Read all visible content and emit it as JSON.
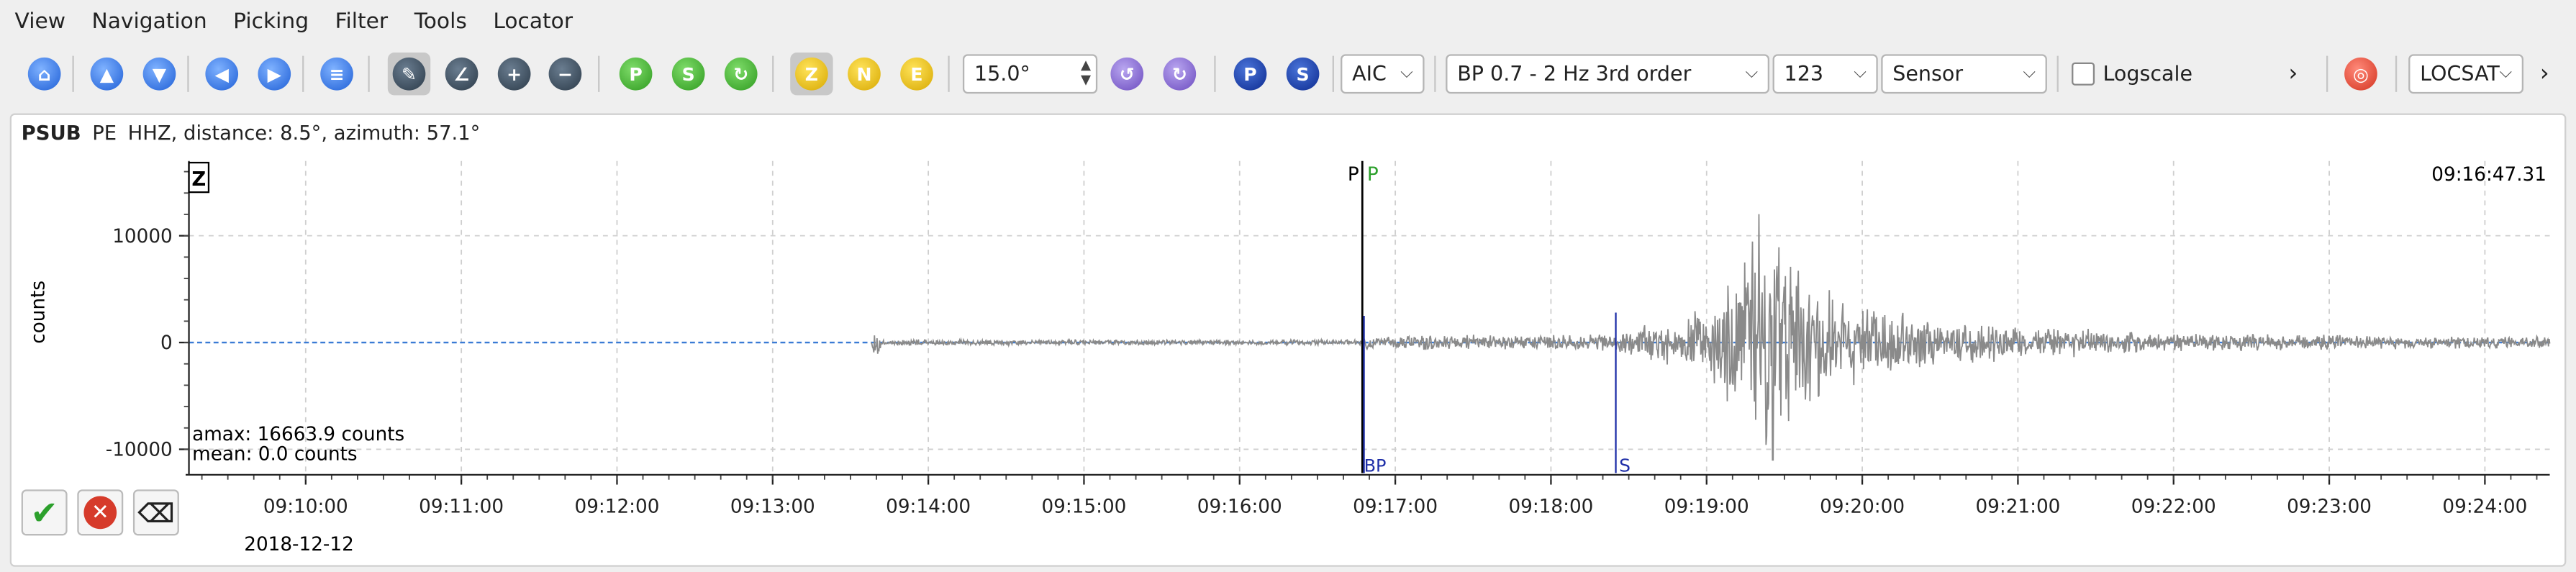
{
  "menu": [
    "View",
    "Navigation",
    "Picking",
    "Filter",
    "Tools",
    "Locator"
  ],
  "toolbar": {
    "angle_value": "15.0°",
    "method": "AIC",
    "filter": "BP 0.7 - 2 Hz  3rd order",
    "components": "123",
    "unit_mode": "Sensor",
    "logscale_label": "Logscale",
    "logscale_checked": false,
    "locator": "LOCSAT",
    "component_buttons": [
      "Z",
      "N",
      "E"
    ],
    "phase_buttons": [
      "P",
      "S"
    ],
    "icons": [
      "home-icon",
      "scroll-up-icon",
      "scroll-down-icon",
      "previous-trace-icon",
      "next-trace-icon",
      "align-icon",
      "pick-tool-icon",
      "angle-tool-icon",
      "zoom-in-icon",
      "zoom-out-icon",
      "pick-p-icon",
      "pick-s-icon",
      "pick-refresh-icon",
      "rotate-left-icon",
      "rotate-right-icon",
      "more-icon",
      "locate-target-icon",
      "overflow-icon"
    ]
  },
  "trace": {
    "station": "PSUB",
    "network": "PE",
    "channel_info": "HHZ, distance: 8.5°, azimuth: 57.1°",
    "component_tag": "Z",
    "time_right": "09:16:47.31",
    "ylabel": "counts",
    "amax_text": "amax: 16663.9 counts",
    "mean_text": "mean: 0.0 counts",
    "date": "2018-12-12",
    "pick_labels": {
      "p_black": "P",
      "p_green": "P",
      "bottom_p": "BP",
      "s": "S"
    }
  },
  "chart_data": {
    "type": "line",
    "title": "",
    "xlabel": "",
    "ylabel": "counts",
    "ylim": [
      -11000,
      17000
    ],
    "yticks": [
      10000,
      0,
      -10000
    ],
    "ytick_labels": [
      "10000",
      "0",
      "-10000"
    ],
    "x_ticks": [
      "09:10:00",
      "09:11:00",
      "09:12:00",
      "09:13:00",
      "09:14:00",
      "09:15:00",
      "09:16:00",
      "09:17:00",
      "09:18:00",
      "09:19:00",
      "09:20:00",
      "09:21:00",
      "09:22:00",
      "09:23:00",
      "09:24:00"
    ],
    "x_start": "09:09:15",
    "x_end": "09:24:25",
    "picks": [
      {
        "label": "P",
        "time": "09:16:47.3",
        "color": "#000000"
      },
      {
        "label": "P",
        "time": "09:16:48.5",
        "color": "#2ca02c"
      },
      {
        "label": "S",
        "time": "09:18:25",
        "color": "#1f2fa8"
      }
    ],
    "envelope": [
      {
        "t": "09:09:15",
        "amp": 0
      },
      {
        "t": "09:13:38",
        "amp": 0
      },
      {
        "t": "09:13:39",
        "amp": 2500
      },
      {
        "t": "09:13:42",
        "amp": 300
      },
      {
        "t": "09:16:47",
        "amp": 250
      },
      {
        "t": "09:16:48",
        "amp": 700
      },
      {
        "t": "09:18:25",
        "amp": 900
      },
      {
        "t": "09:19:00",
        "amp": 3500
      },
      {
        "t": "09:19:15",
        "amp": 9000
      },
      {
        "t": "09:19:20",
        "amp": 16663.9
      },
      {
        "t": "09:19:40",
        "amp": 6000
      },
      {
        "t": "09:20:30",
        "amp": 2200
      },
      {
        "t": "09:22:00",
        "amp": 900
      },
      {
        "t": "09:24:25",
        "amp": 600
      }
    ],
    "grid": true,
    "zero_line": "dashed-blue"
  },
  "colors": {
    "trace": "#8a8a8a",
    "zero_line": "#3a7bd5",
    "grid": "#cfcfcf",
    "pick_p_black": "#000000",
    "pick_p_green": "#2ca02c",
    "pick_s": "#1f2fa8"
  },
  "bottom_buttons": [
    "accept-check-icon",
    "cancel-x-icon",
    "delete-x-icon"
  ]
}
